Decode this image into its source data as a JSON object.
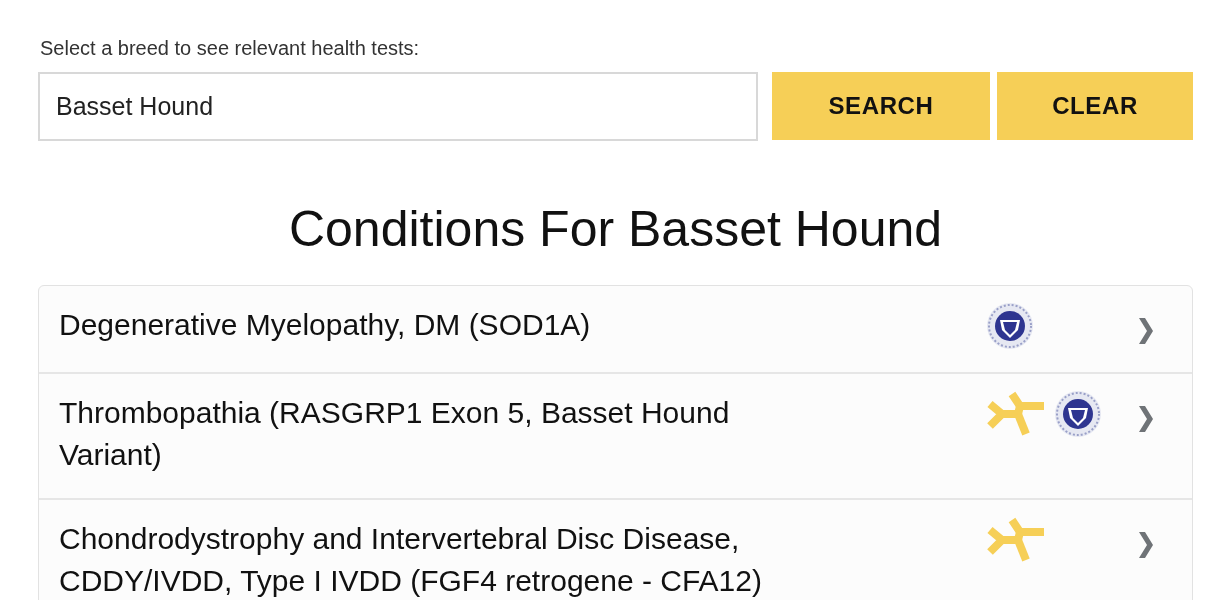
{
  "search": {
    "label": "Select a breed to see relevant health tests:",
    "value": "Basset Hound",
    "buttons": [
      "SEARCH",
      "CLEAR"
    ]
  },
  "heading": "Conditions For Basset Hound",
  "conditions": [
    {
      "name": "Degenerative Myelopathy, DM (SOD1A)",
      "tests": [
        {
          "kind": "seal"
        }
      ]
    },
    {
      "name": "Thrombopathia (RASGRP1 Exon 5, Basset Hound Variant)",
      "tests": [
        {
          "kind": "antibody"
        },
        {
          "kind": "seal"
        }
      ]
    },
    {
      "name": "Chondrodystrophy and Intervertebral Disc Disease, CDDY/IVDD, Type I IVDD (FGF4 retrogene - CFA12)",
      "tests": [
        {
          "kind": "antibody"
        }
      ]
    }
  ]
}
